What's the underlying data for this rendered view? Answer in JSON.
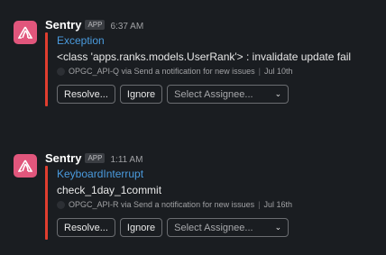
{
  "messages": [
    {
      "sender": "Sentry",
      "badge": "APP",
      "time": "6:37 AM",
      "title": "Exception",
      "body": "<class 'apps.ranks.models.UserRank'> : invalidate update fail",
      "source": "OPGC_API-Q via Send a notification for new issues",
      "date": "Jul 10th",
      "resolve_label": "Resolve...",
      "ignore_label": "Ignore",
      "assignee_placeholder": "Select Assignee...",
      "chevron": "⌄"
    },
    {
      "sender": "Sentry",
      "badge": "APP",
      "time": "1:11 AM",
      "title": "KeyboardInterrupt",
      "body": "check_1day_1commit",
      "source": "OPGC_API-R via Send a notification for new issues",
      "date": "Jul 16th",
      "resolve_label": "Resolve...",
      "ignore_label": "Ignore",
      "assignee_placeholder": "Select Assignee...",
      "chevron": "⌄"
    }
  ],
  "colors": {
    "background": "#1a1d21",
    "accent_bar": "#e03e2f",
    "title_link": "#4a9bde",
    "sentry_brand": "#e1567c"
  },
  "icons": {
    "avatar": "sentry-logo-icon"
  }
}
